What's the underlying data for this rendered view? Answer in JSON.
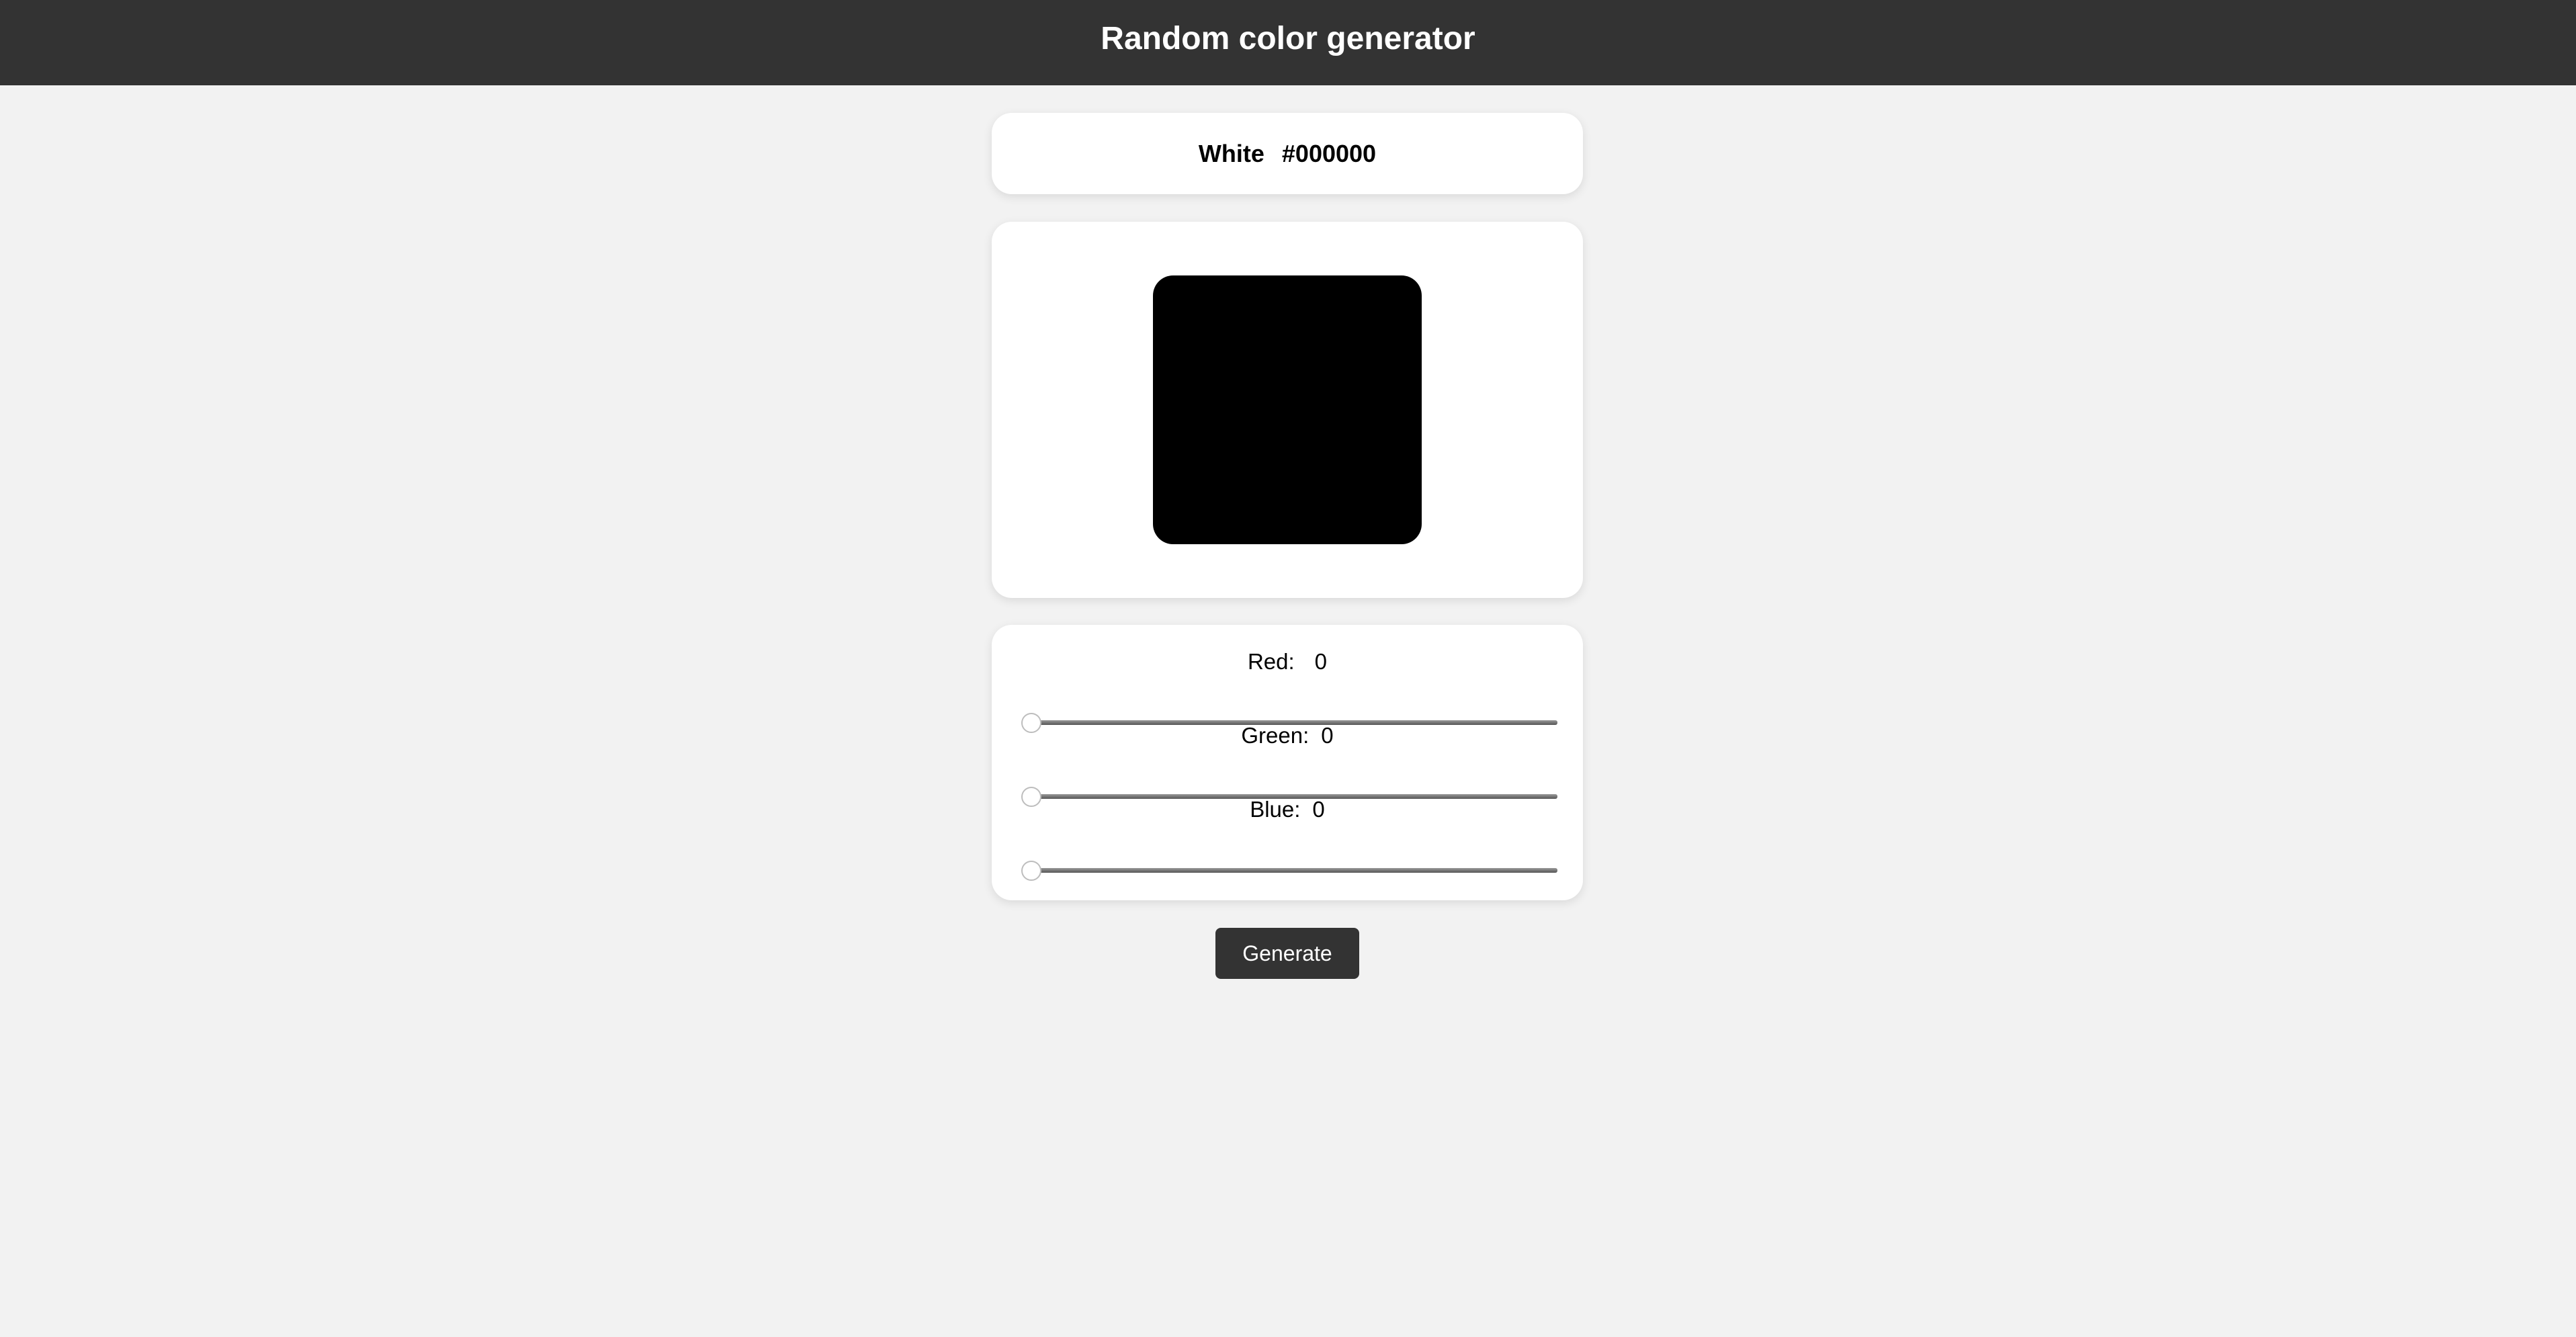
{
  "header": {
    "title": "Random color generator"
  },
  "color": {
    "name": "White",
    "hex": "#000000",
    "swatch_color": "#000000"
  },
  "sliders": [
    {
      "label": "Red:",
      "value": "0",
      "fraction": 0
    },
    {
      "label": "Green:",
      "value": "0",
      "fraction": 0
    },
    {
      "label": "Blue:",
      "value": "0",
      "fraction": 0
    }
  ],
  "actions": {
    "generate_label": "Generate"
  },
  "theme": {
    "header_bg": "#333333",
    "page_bg": "#f2f2f2",
    "card_bg": "#ffffff"
  }
}
